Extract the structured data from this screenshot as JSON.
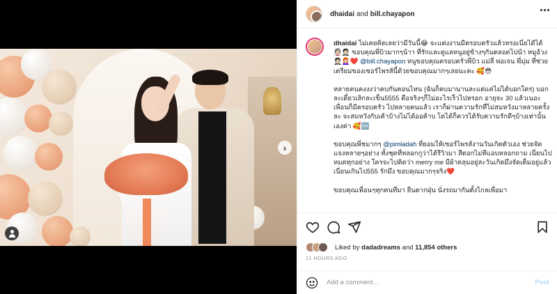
{
  "post": {
    "author": "dhaidai",
    "and_text": "and",
    "coauthor": "bill.chayapon",
    "media": {
      "carousel_count": 5,
      "active_index": 0
    }
  },
  "caption": {
    "user": "dhaidai",
    "p1_a": "ไม่เคยคิดเลยว่ามีวันนี้😂 จะแต่งงานมีครอบครัวแล้วหรอเนี่ยได้ได้ 👰🏻🤵🏻 ขอบคุณพี่บิวมากๆน้าา ที่รักและดูแลหนูอยู่ข้างๆกันตลอดไปน้า หมูอ้วง🤵🏻👩🏻‍🦰❤️ ",
    "p1_mention": "@bill.chayapon",
    "p1_b": " หนูขอบคุณครอบครัวพี่บิว แม่ลี่ พ่อเจน พี่มุ่ม ที่ช่วยเตรียมของเซอร์ไพรส์นี้ด้วยขอบคุณมากๆเลยนะคะ 🥰😳",
    "p2": "หลายคนคงงงว่าคบกันตอนไหน (ฉันก็คบมานานละแต่แค่ไม่ได้บอกใคร) บอกละเดี๋ยวเลิกละเข็น5555 คือจริงๆก็ไม่อะไรเร็วไปหรอก อายุจะ 30 แล้วเนอะ เพื่อนก็มีครอบครัว ไปหลายคนแล้ว เราก็ผ่านความรักที่ไม่สมหวังมาหลายครั้งละ จะสมหวังกับเค้าบ้างไม่ได้ออค้าบ โดได้ก็ควรได้รับความรักดีๆบ้างเท่านั้นเองค่า 🥰🆒",
    "p3_a": "ขอบคุณพี่ชมากๆ ",
    "p3_mention": "@pimladah",
    "p3_b": " ที่ยอมให้เซอร์ไพรส์งานวันเกิดตัวเอง ช่วยจัดแจงหลายๆอย่าง ทั้งชุดที่หลอกกูว่าได้รีวิวมา สีตอกไม่ทีแอบหลอกถาม เนี่ยนไปหมดทุกอย่าง ใครจะไปคิดว่า merry me มีผ้าคลุมอยู่ละวันเกิดมึงจัดเต็มอยู่แล้ว เนี่ยนเกินไป555 รักมึง ขอบคุณมากๆจริง❤️",
    "p4": "ขอบคุณเพื่อนๆทุกคนที่มา ยืนตากฝุ่น นั่งรถมากันตั้งไกลเพื่อมา"
  },
  "likes": {
    "prefix": "Liked by",
    "user": "dadadreams",
    "and_text": "and",
    "count_text": "11,854 others"
  },
  "timestamp": "21 HOURS AGO",
  "comment": {
    "placeholder": "Add a comment...",
    "post_label": "Post"
  },
  "icons": {
    "more": "more-dots-icon",
    "next": "chevron-right-icon",
    "tag": "person-tag-icon",
    "like": "heart-icon",
    "comment": "comment-bubble-icon",
    "share": "share-paper-plane-icon",
    "save": "bookmark-icon",
    "emoji": "smiley-emoji-icon"
  },
  "colors": {
    "text": "#262626",
    "muted": "#8e8e8e",
    "mention": "#00376b",
    "post_disabled": "#b3dbff",
    "story_ring": "#e1306c"
  }
}
